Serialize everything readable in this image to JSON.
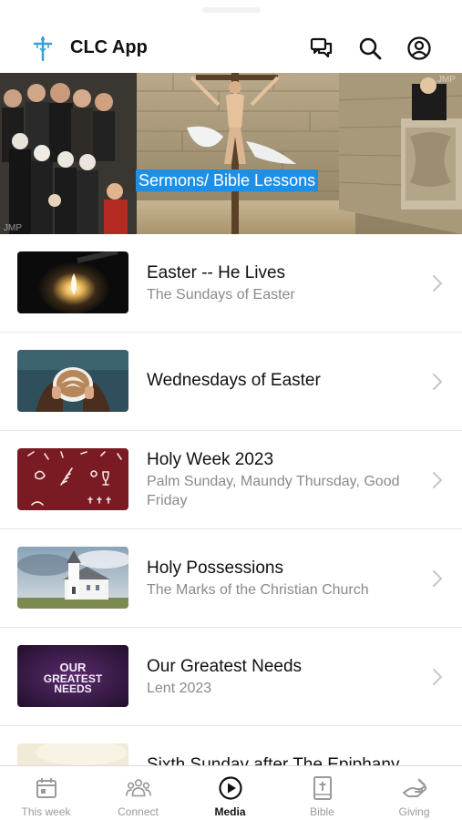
{
  "header": {
    "app_title": "CLC App",
    "logo_icon": "cross-logo-icon",
    "icons": [
      "chat-icon",
      "search-icon",
      "account-icon"
    ]
  },
  "banner": {
    "label": "Sermons/ Bible Lessons",
    "watermarks": [
      "JMP",
      "JMP"
    ]
  },
  "series": [
    {
      "title": "Easter -- He Lives",
      "subtitle": "The Sundays of Easter",
      "thumb": "candle-flame"
    },
    {
      "title": "Wednesdays of Easter",
      "subtitle": "",
      "thumb": "latte-cup"
    },
    {
      "title": "Holy Week 2023",
      "subtitle": "Palm Sunday, Maundy Thursday, Good Friday",
      "thumb": "holy-week-symbols"
    },
    {
      "title": "Holy Possessions",
      "subtitle": "The Marks of the Christian Church",
      "thumb": "country-church"
    },
    {
      "title": "Our Greatest Needs",
      "subtitle": "Lent 2023",
      "thumb": "our-greatest-needs",
      "thumb_text": "OUR GREATEST NEEDS"
    },
    {
      "title": "Sixth Sunday after The Epiphany",
      "subtitle": "",
      "thumb": "pale-light"
    }
  ],
  "tabbar": {
    "tabs": [
      {
        "label": "This week",
        "icon": "calendar-icon",
        "active": false
      },
      {
        "label": "Connect",
        "icon": "people-icon",
        "active": false
      },
      {
        "label": "Media",
        "icon": "play-icon",
        "active": true
      },
      {
        "label": "Bible",
        "icon": "bible-icon",
        "active": false
      },
      {
        "label": "Giving",
        "icon": "giving-hand-icon",
        "active": false
      }
    ]
  },
  "colors": {
    "banner_label_bg": "#1f8fe6",
    "logo": "#3aa0d8",
    "active_tab": "#111111",
    "inactive_tab": "#9a9a9a"
  }
}
